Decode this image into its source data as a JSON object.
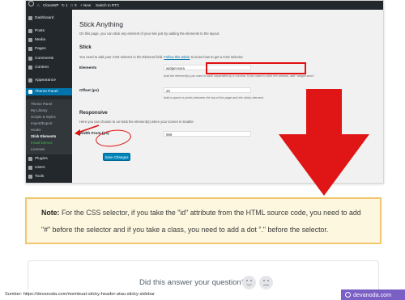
{
  "admin_bar": {
    "site": "CloneWP",
    "updates": "1",
    "comments": "0",
    "new_label": "+ New",
    "switch_label": "Switch to RTC"
  },
  "sidebar": {
    "items": [
      {
        "label": "Dashboard"
      },
      {
        "label": "Posts"
      },
      {
        "label": "Media"
      },
      {
        "label": "Pages"
      },
      {
        "label": "Comments"
      },
      {
        "label": "Content"
      },
      {
        "label": "Appearance"
      },
      {
        "label": "Theme Panel"
      }
    ],
    "submenu": [
      {
        "label": "Theme Panel"
      },
      {
        "label": "My Library"
      },
      {
        "label": "Scripts & Styles"
      },
      {
        "label": "Import/Export"
      },
      {
        "label": "Hooks"
      },
      {
        "label": "Stick Elements"
      },
      {
        "label": "Install Demos"
      },
      {
        "label": "Licenses"
      }
    ],
    "bottom_items": [
      {
        "label": "Plugins"
      },
      {
        "label": "Users"
      },
      {
        "label": "Tools"
      }
    ]
  },
  "settings": {
    "title": "Stick Anything",
    "intro": "On this page, you can stick any element of your site just by adding the elements to the layout.",
    "stick_heading": "Stick",
    "stick_help_prefix": "You need to add your CSS selector in the Element field.",
    "stick_help_link": "Follow this article",
    "stick_help_suffix": "to know how to get a CSS selector.",
    "elements_label": "Elements",
    "elements_value": "widget-area",
    "elements_desc": "Add the element(s) you want to stick separated by a comma. If you want to stick the sidebar, add \"widget-area\".",
    "offset_label": "Offset (px)",
    "offset_value": "20",
    "offset_desc": "Add a space in pixels between the top of the page and the sticky element.",
    "responsive_heading": "Responsive",
    "responsive_help": "Here you can choose to un-stick the element(s) when your screen is smaller.",
    "width_label": "Width From (px)",
    "width_value": "959",
    "save_label": "Save Changes"
  },
  "note": {
    "label": "Note:",
    "line1": "For the CSS selector, if you take the \"id\" attribute from the HTML source code, you need to add",
    "line2": "\"#\" before the selector and if you take a class, you need to add a dot \".\" before the selector."
  },
  "feedback": {
    "question": "Did this answer your question?"
  },
  "footer": {
    "source": "Sumber: https://devanoda.com/membuat-sticky-header-atau-sticky-sidebar",
    "brand": "devanoda.com"
  },
  "colors": {
    "admin_dark": "#23282d",
    "admin_blue": "#0073aa",
    "highlight_red": "#e01010",
    "note_border": "#f2c66f",
    "note_bg": "#fdf7e0",
    "brand_purple": "#7a5fc4"
  },
  "icons": {
    "arrow": "big-red-down-arrow",
    "happy": "smile-emoji",
    "neutral": "neutral-emoji"
  }
}
